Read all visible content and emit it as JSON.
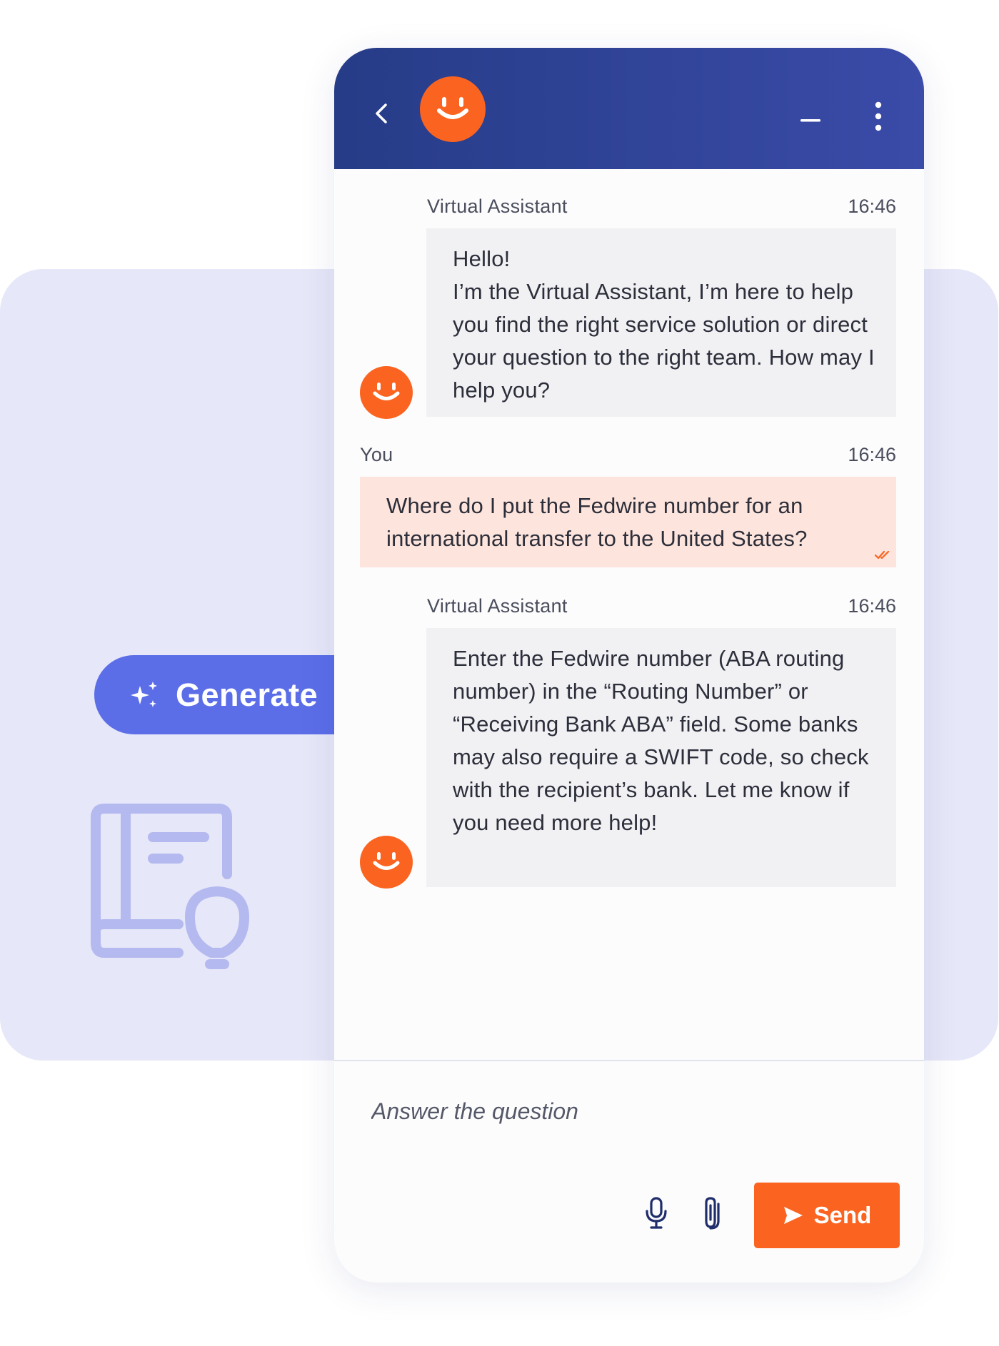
{
  "colors": {
    "header_bg": "#2d3f91",
    "accent": "#fa6420",
    "generate_bg": "#5b6ee8",
    "user_bubble": "#fde4dc",
    "bot_bubble": "#f1f1f4",
    "panel_bg": "#e6e7f8"
  },
  "header": {
    "back_icon": "chevron-left-icon",
    "avatar_icon": "smiley-avatar-icon",
    "minimize_icon": "minimize-icon",
    "menu_icon": "vertical-dots-icon"
  },
  "generate": {
    "label": "Generate",
    "icon": "sparkle-icon"
  },
  "messages": [
    {
      "sender": "Virtual Assistant",
      "time": "16:46",
      "text": "Hello!\nI’m the Virtual Assistant, I’m here to help you find the right service solution or direct your question to the right team. How may I help you?"
    },
    {
      "sender": "You",
      "time": "16:46",
      "text": "Where do I put the Fedwire number for an international transfer to the United States?"
    },
    {
      "sender": "Virtual Assistant",
      "time": "16:46",
      "text": "Enter the Fedwire number (ABA routing number) in the “Routing Number” or “Receiving Bank ABA” field. Some banks may also require a SWIFT code, so check with the recipient’s bank. Let me know if you need more help!"
    }
  ],
  "composer": {
    "placeholder": "Answer the question",
    "send_label": "Send",
    "mic_icon": "microphone-icon",
    "attach_icon": "paperclip-icon"
  },
  "decor": {
    "book_icon": "knowledge-book-lightbulb-icon"
  }
}
